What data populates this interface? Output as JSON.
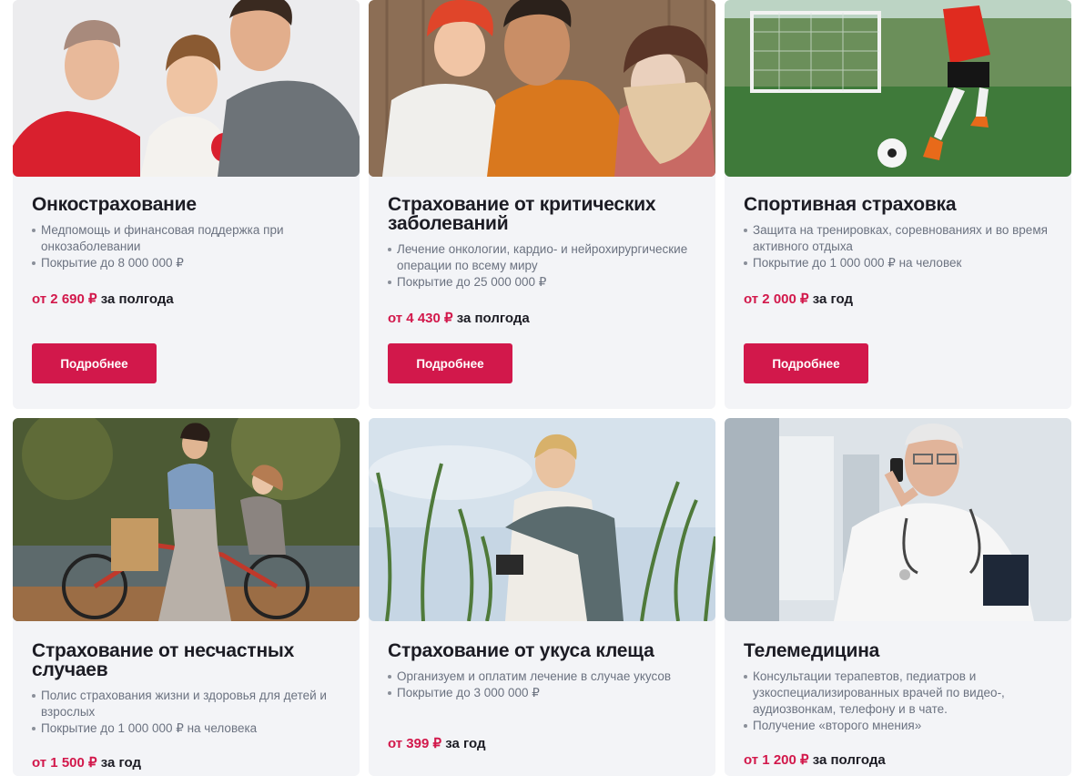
{
  "cards": [
    {
      "title": "Онкострахование",
      "bullets": [
        "Медпомощь и финансовая поддержка  при онкозаболевании",
        "Покрытие до 8 000 000 ₽"
      ],
      "price_amount": "от 2 690 ₽",
      "price_period": " за полгода",
      "button_label": "Подробнее",
      "image": "family-portrait-photo"
    },
    {
      "title": "Страхование от критических заболеваний",
      "bullets": [
        "Лечение онкологии, кардио- и нейрохирургические операции  по всему миру",
        "Покрытие до 25 000 000 ₽"
      ],
      "price_amount": "от 4 430 ₽",
      "price_period": " за полгода",
      "button_label": "Подробнее",
      "image": "family-autumn-photo"
    },
    {
      "title": "Спортивная страховка",
      "bullets": [
        "Защита на тренировках, соревнованиях и во время активного отдыха",
        "Покрытие до 1 000 000 ₽ на человек"
      ],
      "price_amount": "от 2 000 ₽",
      "price_period": " за год",
      "button_label": "Подробнее",
      "image": "football-player-photo"
    },
    {
      "title": "Страхование от несчастных случаев",
      "bullets": [
        "Полис страхования жизни и здоровья для детей и взрослых",
        "Покрытие до 1 000 000 ₽ на человека"
      ],
      "price_amount": "от 1 500 ₽",
      "price_period": " за год",
      "image": "bicycle-family-photo"
    },
    {
      "title": "Страхование от укуса клеща",
      "bullets": [
        "Организуем и оплатим лечение  в случае укусов",
        "Покрытие до 3 000 000 ₽"
      ],
      "price_amount": "от 399 ₽",
      "price_period": " за год",
      "image": "woman-in-grass-photo"
    },
    {
      "title": "Телемедицина",
      "bullets": [
        "Консультации терапевтов, педиатров  и узкоспециализированных врачей по видео-, аудиозвонкам, телефону и в чате.",
        "Получение «второго мнения»"
      ],
      "price_amount": "от 1 200 ₽",
      "price_period": " за полгода",
      "image": "doctor-on-phone-photo"
    }
  ],
  "colors": {
    "accent": "#d2184b",
    "card_bg": "#f3f4f7",
    "title": "#1c1c24",
    "muted": "#6b7280"
  }
}
